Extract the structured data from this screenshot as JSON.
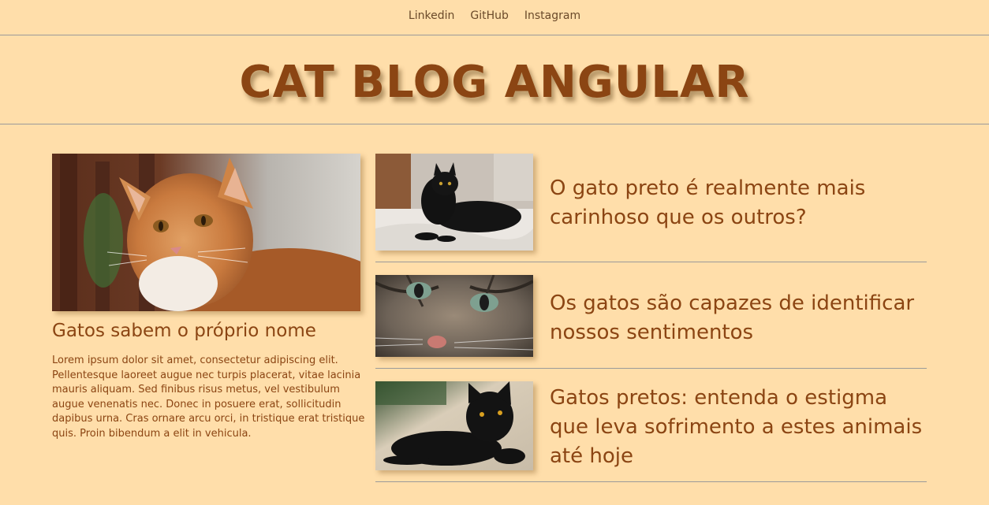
{
  "nav": {
    "links": [
      "Linkedin",
      "GitHub",
      "Instagram"
    ]
  },
  "header": {
    "title": "CAT BLOG ANGULAR"
  },
  "feature": {
    "image": "orange-tabby-cat-photo",
    "title": "Gatos sabem o próprio nome",
    "text": "Lorem ipsum dolor sit amet, consectetur adipiscing elit. Pellentesque laoreet augue nec turpis placerat, vitae lacinia mauris aliquam. Sed finibus risus metus, vel vestibulum augue venenatis nec. Donec in posuere erat, sollicitudin dapibus urna. Cras ornare arcu orci, in tristique erat tristique quis. Proin bibendum a elit in vehicula."
  },
  "posts": [
    {
      "image": "black-cat-on-bed-photo",
      "title": "O gato preto é realmente mais carinhoso que os outros?"
    },
    {
      "image": "grey-tabby-closeup-photo",
      "title": "Os gatos são capazes de identificar nossos sentimentos"
    },
    {
      "image": "black-cat-lying-photo",
      "title": "Gatos pretos: entenda o estigma que leva sofrimento a estes animais até hoje"
    }
  ],
  "colors": {
    "background": "#FFDEAA",
    "accent": "#8B4513",
    "divider": "#9A9A9A"
  }
}
